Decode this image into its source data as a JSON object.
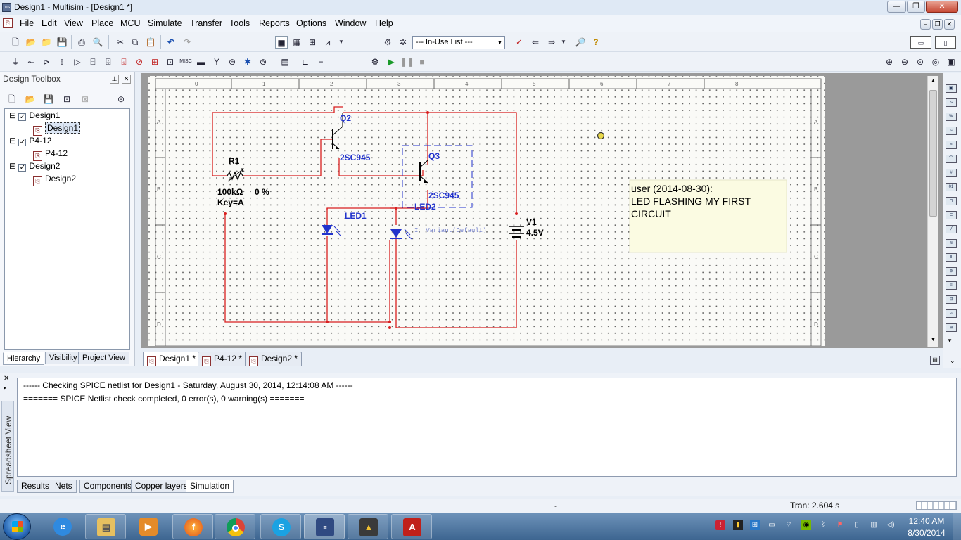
{
  "window": {
    "title": "Design1 - Multisim - [Design1 *]",
    "min": "—",
    "restore": "❐",
    "close": "✕",
    "doc_min": "–",
    "doc_restore": "❐",
    "doc_close": "✕"
  },
  "menu": [
    "File",
    "Edit",
    "View",
    "Place",
    "MCU",
    "Simulate",
    "Transfer",
    "Tools",
    "Reports",
    "Options",
    "Window",
    "Help"
  ],
  "toolbar": {
    "inuse_list": "--- In-Use List ---"
  },
  "design_toolbox": {
    "title": "Design Toolbox",
    "tree": [
      {
        "label": "Design1",
        "level": 0,
        "expand": "⊟",
        "check": "✓"
      },
      {
        "label": "Design1",
        "level": 1,
        "selected": true
      },
      {
        "label": "P4-12",
        "level": 0,
        "expand": "⊟",
        "check": "✓"
      },
      {
        "label": "P4-12",
        "level": 1
      },
      {
        "label": "Design2",
        "level": 0,
        "expand": "⊟",
        "check": "✓"
      },
      {
        "label": "Design2",
        "level": 1
      }
    ],
    "tabs": [
      "Hierarchy",
      "Visibility",
      "Project View"
    ]
  },
  "schematic": {
    "r1_label": "R1",
    "r1_value": "100kΩ",
    "r1_percent": "0 %",
    "r1_key": "Key=A",
    "q2_label": "Q2",
    "q2_type": "2SC945",
    "q3_label": "Q3",
    "q3_type": "2SC945",
    "led1_label": "LED1",
    "led2_label": "LED2",
    "variant": "In Variant(Default)",
    "v1_label": "V1",
    "v1_value": "4.5V",
    "note_line1": "user (2014-08-30):",
    "note_line2": "LED FLASHING MY FIRST",
    "note_line3": "CIRCUIT",
    "ruler_top": [
      "0",
      "1",
      "2",
      "3",
      "4",
      "5",
      "6",
      "7",
      "8"
    ],
    "ruler_side": [
      "A",
      "B",
      "C",
      "D"
    ]
  },
  "sheet_tabs": [
    "Design1 *",
    "P4-12 *",
    "Design2 *"
  ],
  "output": {
    "line1": "------ Checking SPICE netlist for Design1 - Saturday, August 30, 2014, 12:14:08 AM ------",
    "line2": "======= SPICE Netlist check completed, 0 error(s), 0 warning(s) =======",
    "side_label": "Spreadsheet View",
    "tabs": [
      "Results",
      "Nets",
      "Components",
      "Copper layers",
      "Simulation"
    ]
  },
  "status": {
    "middle": "-",
    "tran": "Tran: 2.604 s"
  },
  "taskbar": {
    "time": "12:40 AM",
    "date": "8/30/2014",
    "apps": [
      "Internet Explorer",
      "Windows Explorer",
      "Media Player",
      "Firefox",
      "Chrome",
      "Skype",
      "Multisim",
      "Launcher",
      "Adobe Reader"
    ]
  }
}
